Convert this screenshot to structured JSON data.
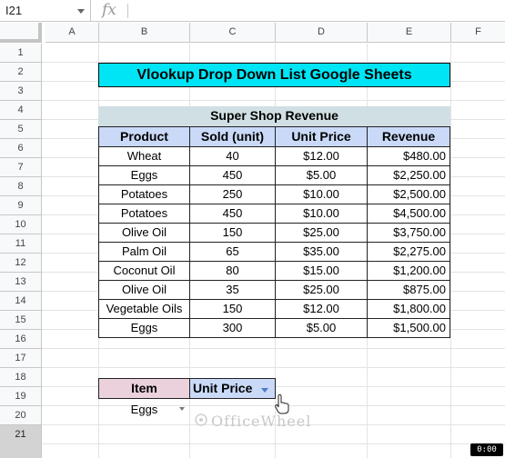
{
  "name_box": "I21",
  "formula_icon": "fx",
  "columns": [
    "A",
    "B",
    "C",
    "D",
    "E",
    "F"
  ],
  "rows": [
    "1",
    "2",
    "3",
    "4",
    "5",
    "6",
    "7",
    "8",
    "9",
    "10",
    "11",
    "12",
    "13",
    "14",
    "15",
    "16",
    "17",
    "18",
    "19",
    "20",
    "21"
  ],
  "selected_row": "21",
  "title": "Vlookup Drop Down List Google Sheets",
  "table": {
    "caption": "Super Shop Revenue",
    "headers": [
      "Product",
      "Sold (unit)",
      "Unit Price",
      "Revenue"
    ],
    "rows": [
      [
        "Wheat",
        "40",
        "$12.00",
        "$480.00"
      ],
      [
        "Eggs",
        "450",
        "$5.00",
        "$2,250.00"
      ],
      [
        "Potatoes",
        "250",
        "$10.00",
        "$2,500.00"
      ],
      [
        "Potatoes",
        "450",
        "$10.00",
        "$4,500.00"
      ],
      [
        "Olive Oil",
        "150",
        "$25.00",
        "$3,750.00"
      ],
      [
        "Palm Oil",
        "65",
        "$35.00",
        "$2,275.00"
      ],
      [
        "Coconut Oil",
        "80",
        "$15.00",
        "$1,200.00"
      ],
      [
        "Olive Oil",
        "35",
        "$25.00",
        "$875.00"
      ],
      [
        "Vegetable Oils",
        "150",
        "$12.00",
        "$1,800.00"
      ],
      [
        "Eggs",
        "300",
        "$5.00",
        "$1,500.00"
      ]
    ]
  },
  "lookup": {
    "item_label": "Item",
    "unit_price_label": "Unit Price",
    "item_value": "Eggs"
  },
  "watermark": "OfficeWheel",
  "badge": "0:00",
  "colors": {
    "title_bg": "#00e5f5",
    "header_bg": "#c9d9f7",
    "caption_bg": "#d0dfe3",
    "item_bg": "#ead1dc"
  }
}
